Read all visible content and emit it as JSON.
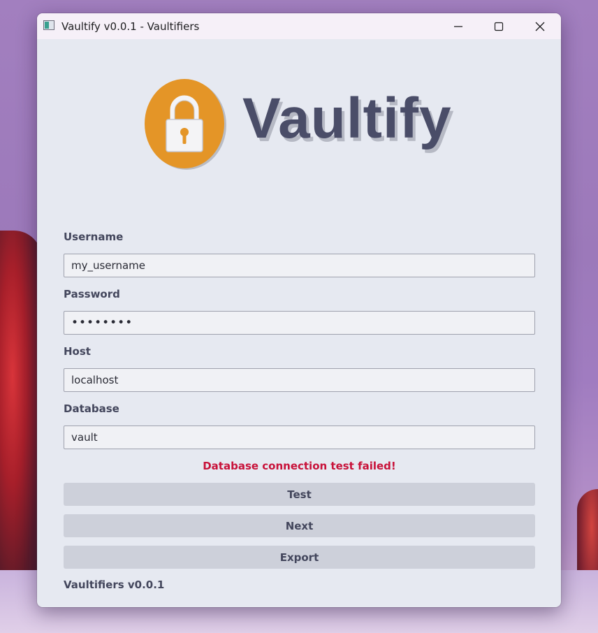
{
  "window": {
    "title": "Vaultify v0.0.1 - Vaultifiers",
    "icon": "app-window-icon",
    "controls": [
      "minimize-icon",
      "maximize-icon",
      "close-icon"
    ]
  },
  "logo": {
    "text": "Vaultify",
    "icon": "padlock-icon",
    "circle_color": "#e49527",
    "text_color": "#4a4d68"
  },
  "form": {
    "username": {
      "label": "Username",
      "value": "my_username"
    },
    "password": {
      "label": "Password",
      "value": "••••••••"
    },
    "host": {
      "label": "Host",
      "value": "localhost"
    },
    "database": {
      "label": "Database",
      "value": "vault"
    }
  },
  "status": {
    "error_message": "Database connection test failed!",
    "error_color": "#c8123a"
  },
  "buttons": {
    "test": "Test",
    "next": "Next",
    "export": "Export"
  },
  "footer": {
    "version": "Vaultifiers v0.0.1"
  }
}
